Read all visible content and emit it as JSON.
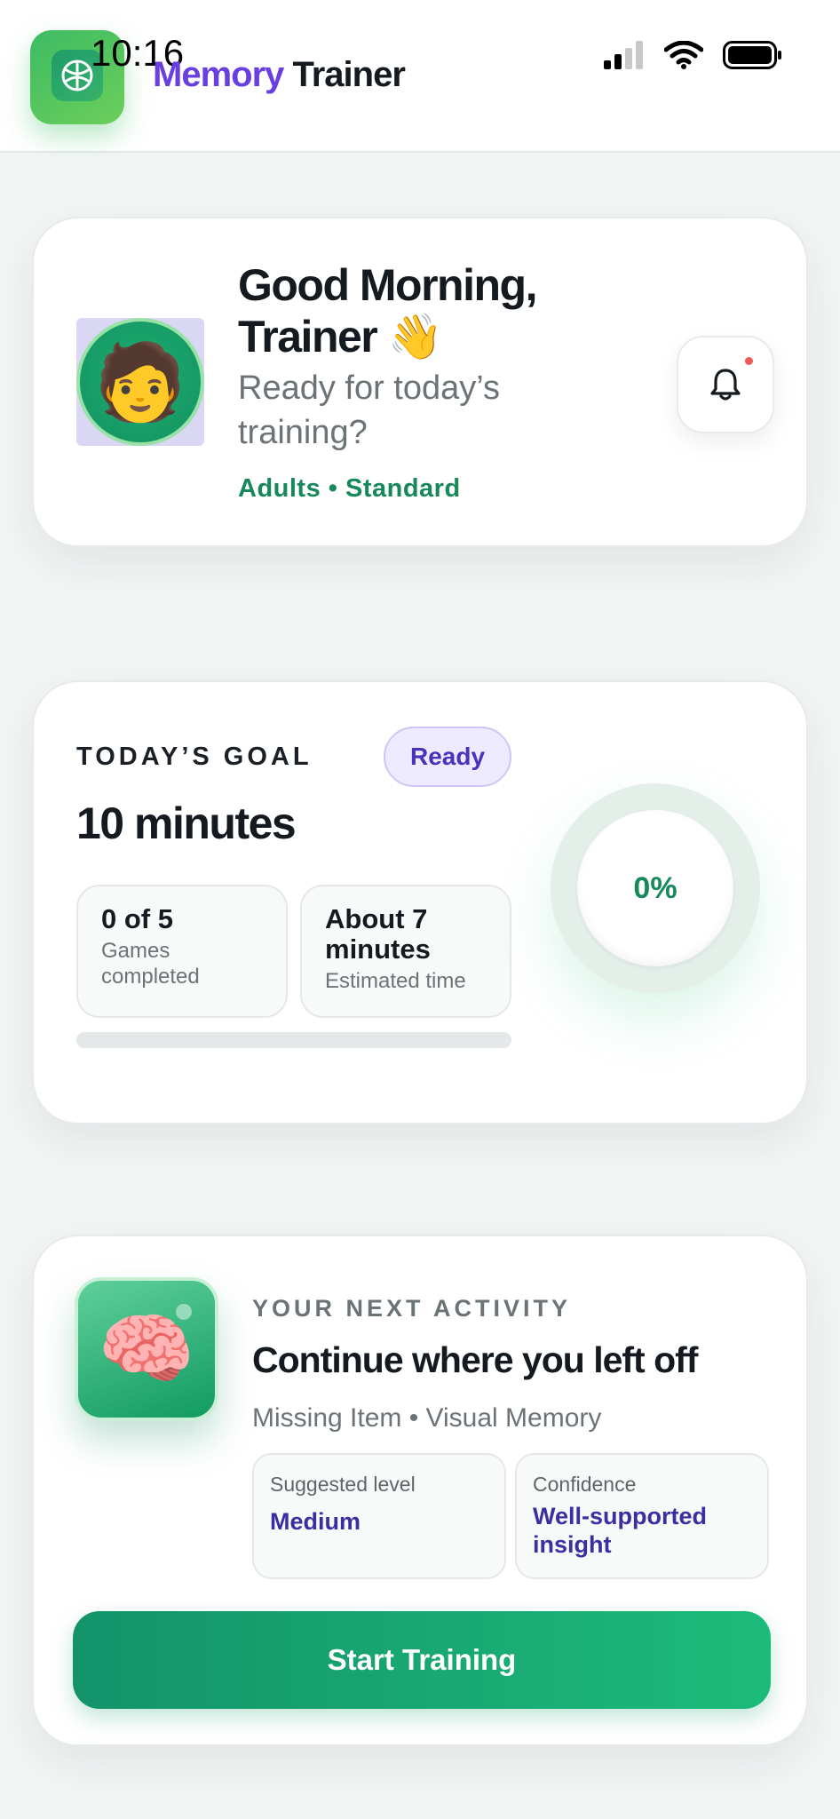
{
  "status_bar": {
    "time": "10:16"
  },
  "header": {
    "brand_part1": "Memory",
    "brand_part2": "Trainer"
  },
  "greeting": {
    "title": "Good Morning, Trainer 👋",
    "subtitle": "Ready for today’s training?",
    "meta": "Adults • Standard",
    "avatar_emoji": "🧑"
  },
  "goal": {
    "label": "TODAY’S GOAL",
    "badge": "Ready",
    "value": "10 minutes",
    "games_main": "0 of 5",
    "games_sub": "Games completed",
    "time_main": "About 7 minutes",
    "time_sub": "Estimated time",
    "progress_text": "0%",
    "progress_fraction": 0
  },
  "activity": {
    "label": "YOUR NEXT ACTIVITY",
    "title": "Continue where you left off",
    "subtitle": "Missing Item • Visual Memory",
    "icon_emoji": "🧠",
    "level_label": "Suggested level",
    "level_value": "Medium",
    "confidence_label": "Confidence",
    "confidence_value": "Well-supported insight",
    "start_label": "Start Training"
  },
  "colors": {
    "accent_green": "#16885a",
    "brand_purple": "#6a3fe0",
    "badge_purple": "#4a33b8"
  }
}
